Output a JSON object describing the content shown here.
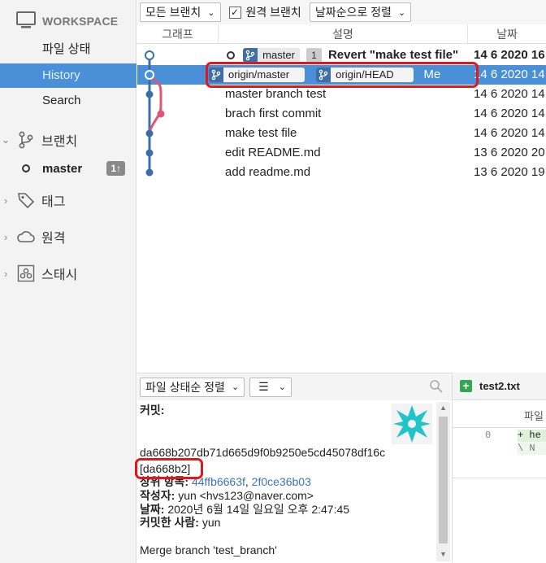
{
  "sidebar": {
    "workspace_title": "WORKSPACE",
    "nav": [
      {
        "label": "파일 상태",
        "active": false
      },
      {
        "label": "History",
        "active": true
      },
      {
        "label": "Search",
        "active": false
      }
    ],
    "sections": {
      "branches": "브랜치",
      "tags": "태그",
      "remotes": "원격",
      "stashes": "스태시"
    },
    "current_branch": {
      "name": "master",
      "ahead": "1↑"
    }
  },
  "toolbar": {
    "branches_filter": "모든 브랜치",
    "remote_branches_label": "원격 브랜치",
    "remote_branches_checked": true,
    "sort": "날짜순으로 정렬"
  },
  "columns": {
    "graph": "그래프",
    "description": "설명",
    "date": "날짜"
  },
  "commits": [
    {
      "refs": [
        {
          "name": "master",
          "kind": "local"
        }
      ],
      "badge": "1",
      "message": "Revert \"make test file\"",
      "bold": true,
      "date": "14 6 2020 16",
      "selected": false
    },
    {
      "refs": [
        {
          "name": "origin/master",
          "kind": "remote"
        },
        {
          "name": "origin/HEAD",
          "kind": "remote"
        }
      ],
      "message": "Me",
      "date": "14 6 2020 14",
      "selected": true
    },
    {
      "refs": [],
      "message": "master branch test",
      "date": "14 6 2020 14",
      "selected": false
    },
    {
      "refs": [],
      "message": "brach first commit",
      "date": "14 6 2020 14",
      "selected": false
    },
    {
      "refs": [],
      "message": "make test file",
      "date": "14 6 2020 14",
      "selected": false
    },
    {
      "refs": [],
      "message": "edit README.md",
      "date": "13 6 2020 20",
      "selected": false
    },
    {
      "refs": [],
      "message": "add readme.md",
      "date": "13 6 2020 19",
      "selected": false
    }
  ],
  "bottom_toolbar": {
    "sort": "파일 상태순 정렬",
    "view_icon": "list-icon",
    "search_icon": "search-icon"
  },
  "detail": {
    "commit_label": "커밋:",
    "hash": "da668b207db71d665d9f0b9250e5cd45078df16c",
    "short_hash": "[da668b2]",
    "parents_label": "상위 항목:",
    "parent1": "44ffb6663f",
    "parent_sep": ",",
    "parent2": "2f0ce36b03",
    "author_label": "작성자:",
    "author": "yun <hvs123@naver.com>",
    "date_label": "날짜:",
    "date": "2020년 6월 14일 일요일 오후 2:47:45",
    "committer_label": "커밋한 사람:",
    "committer": "yun",
    "message": "Merge branch 'test_branch'"
  },
  "file_pane": {
    "file_name": "test2.txt",
    "column_label": "파일",
    "line_no": "0",
    "diff_add": "+ he",
    "diff_meta": "\\ N"
  },
  "colors": {
    "accent": "#4a90d9",
    "graph_blue": "#3d6ea8",
    "graph_pink": "#e05575",
    "highlight": "#e0181d",
    "added_green": "#33a853"
  }
}
